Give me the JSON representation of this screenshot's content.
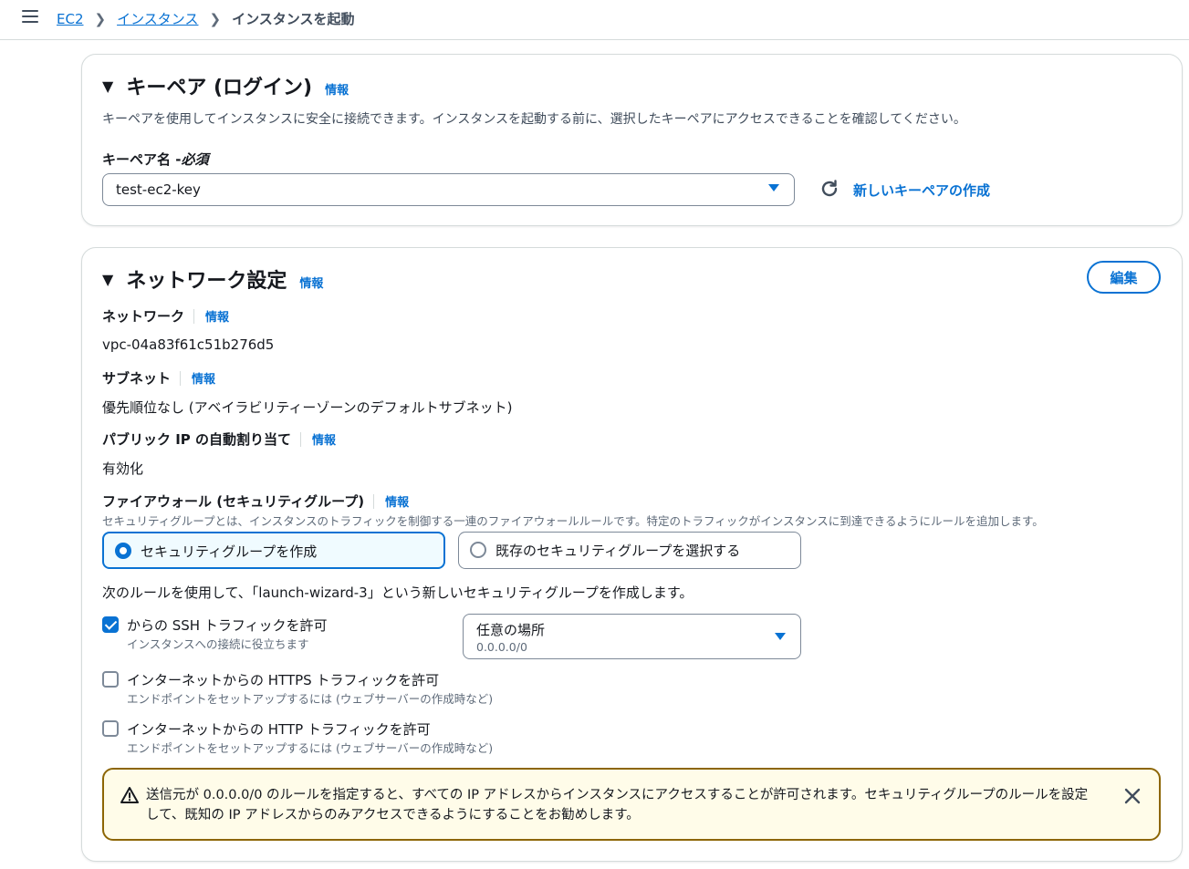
{
  "breadcrumb": {
    "items": [
      "EC2",
      "インスタンス"
    ],
    "current": "インスタンスを起動"
  },
  "keypair": {
    "title": "キーペア (ログイン)",
    "info": "情報",
    "description": "キーペアを使用してインスタンスに安全に接続できます。インスタンスを起動する前に、選択したキーペアにアクセスできることを確認してください。",
    "field_label": "キーペア名 - ",
    "field_required": "必須",
    "selected": "test-ec2-key",
    "create_link": "新しいキーペアの作成"
  },
  "network": {
    "title": "ネットワーク設定",
    "info": "情報",
    "edit_button": "編集",
    "network_label": "ネットワーク",
    "network_value": "vpc-04a83f61c51b276d5",
    "subnet_label": "サブネット",
    "subnet_value": "優先順位なし (アベイラビリティーゾーンのデフォルトサブネット)",
    "public_ip_label": "パブリック IP の自動割り当て",
    "public_ip_value": "有効化",
    "firewall_label": "ファイアウォール (セキュリティグループ)",
    "firewall_description": "セキュリティグループとは、インスタンスのトラフィックを制御する一連のファイアウォールルールです。特定のトラフィックがインスタンスに到達できるようにルールを追加します。",
    "options": [
      {
        "label": "セキュリティグループを作成",
        "selected": true
      },
      {
        "label": "既存のセキュリティグループを選択する",
        "selected": false
      }
    ],
    "rules_intro": "次のルールを使用して、「launch-wizard-3」という新しいセキュリティグループを作成します。",
    "rules": [
      {
        "label": "からの SSH トラフィックを許可",
        "description": "インスタンスへの接続に役立ちます",
        "checked": true
      },
      {
        "label": "インターネットからの HTTPS トラフィックを許可",
        "description": "エンドポイントをセットアップするには (ウェブサーバーの作成時など)",
        "checked": false
      },
      {
        "label": "インターネットからの HTTP トラフィックを許可",
        "description": "エンドポイントをセットアップするには (ウェブサーバーの作成時など)",
        "checked": false
      }
    ],
    "ssh_source": {
      "value": "任意の場所",
      "subvalue": "0.0.0.0/0"
    },
    "warning": "送信元が 0.0.0.0/0 のルールを指定すると、すべての IP アドレスからインスタンスにアクセスすることが許可されます。セキュリティグループのルールを設定して、既知の IP アドレスからのみアクセスできるようにすることをお勧めします。"
  },
  "colors": {
    "link": "#0972d3",
    "warning_border": "#8d6605",
    "warning_bg": "#fffce9"
  }
}
